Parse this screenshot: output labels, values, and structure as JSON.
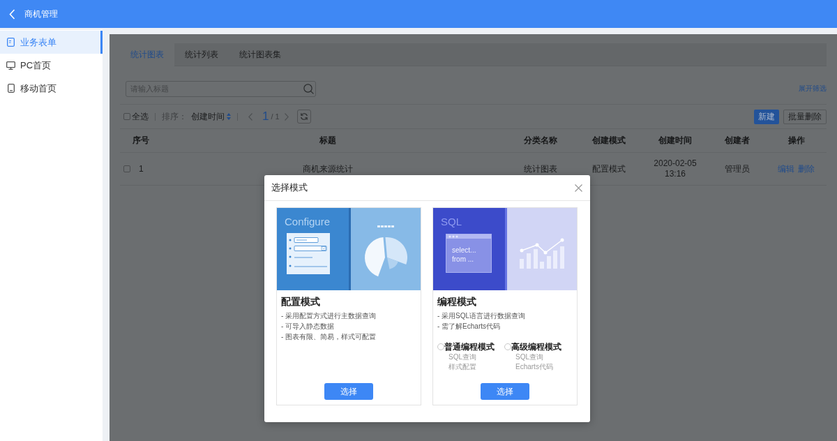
{
  "header": {
    "title": "商机管理"
  },
  "sidebar": {
    "items": [
      {
        "label": "业务表单",
        "kind": "form",
        "selected": true
      },
      {
        "label": "PC首页",
        "kind": "monitor",
        "selected": false
      },
      {
        "label": "移动首页",
        "kind": "tablet",
        "selected": false
      }
    ]
  },
  "tabs": [
    {
      "label": "统计图表",
      "selected": true
    },
    {
      "label": "统计列表",
      "selected": false
    },
    {
      "label": "统计图表集",
      "selected": false
    }
  ],
  "search": {
    "placeholder": "请输入标题"
  },
  "filter_link": "展开筛选",
  "toolbar": {
    "select_all": {
      "label": "全选",
      "checked": false
    },
    "sort_label": "排序：",
    "sort_field": "创建时间",
    "page": "1",
    "page_total": "/ 1",
    "buttons": [
      {
        "label": "新建",
        "kind": "primary"
      },
      {
        "label": "批量删除",
        "kind": "default"
      }
    ]
  },
  "table": {
    "columns": [
      "序号",
      "标题",
      "分类名称",
      "创建模式",
      "创建时间",
      "创建者",
      "操作"
    ],
    "rows": [
      {
        "checked": false,
        "cells": [
          "1",
          "商机来源统计",
          "统计图表",
          "配置模式",
          "2020-02-05 13:16",
          "管理员"
        ],
        "actions": [
          "编辑",
          "删除"
        ]
      }
    ]
  },
  "modal": {
    "title": "选择模式",
    "cards": [
      {
        "kind": "configure",
        "art_title": "Configure",
        "title": "配置模式",
        "lines": [
          "- 采用配置方式进行主数据查询",
          "- 可导入静态数据",
          "- 图表有限、简易，样式可配置"
        ],
        "button": "选择"
      },
      {
        "kind": "code",
        "art_title": "SQL",
        "code_lines": [
          "select...",
          "from ..."
        ],
        "title": "编程模式",
        "lines": [
          "- 采用SQL语言进行数据查询",
          "- 需了解Echarts代码"
        ],
        "options": [
          {
            "label": "普通编程模式",
            "selected": false,
            "notes": [
              "SQL查询",
              "样式配置"
            ]
          },
          {
            "label": "高级编程模式",
            "selected": false,
            "notes": [
              "SQL查询",
              "Echarts代码"
            ]
          }
        ],
        "button": "选择"
      }
    ]
  }
}
